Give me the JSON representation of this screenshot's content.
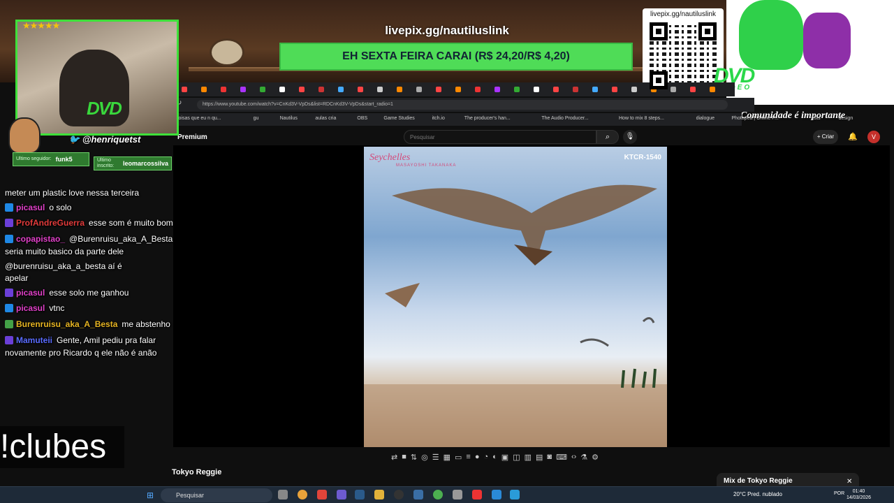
{
  "overlay": {
    "livepix": "livepix.gg/nautiluslink",
    "goal_text": "EH SEXTA FEIRA CARAI (R$ 24,20/R$ 4,20)",
    "qr_url": "livepix.gg/nautiluslink",
    "dvd_logo": "DVD",
    "dvd_sub": "VIDEO",
    "community": "Comunidade é importante",
    "stars": "★★★★★",
    "twitter_handle": "@henriquetst",
    "last_follower_label": "Ultimo seguidor:",
    "last_follower": "funk5",
    "last_sub_label": "Ultimo inscrito:",
    "last_sub": "leomarcossilva",
    "clubes": "!clubes"
  },
  "chat": [
    {
      "user": "",
      "color": "#ffffff",
      "text": "meter um plastic love nessa terceira"
    },
    {
      "user": "picasul",
      "color": "#e040c8",
      "text": "o solo"
    },
    {
      "user": "ProfAndreGuerra",
      "color": "#e33b3b",
      "text": "esse som é muito bom"
    },
    {
      "user": "copapistao_",
      "color": "#e040c8",
      "text": "@Burenruisu_aka_A_Besta"
    },
    {
      "user": "",
      "color": "#ffffff",
      "text": "seria muito basico da parte dele"
    },
    {
      "user": "",
      "color": "#ffffff",
      "text": "@burenruisu_aka_a_besta aí é"
    },
    {
      "user": "",
      "color": "#ffffff",
      "text": "apelar"
    },
    {
      "user": "picasul",
      "color": "#e040c8",
      "text": "esse solo me ganhou"
    },
    {
      "user": "picasul",
      "color": "#e040c8",
      "text": "vtnc"
    },
    {
      "user": "Burenruisu_aka_A_Besta",
      "color": "#e6b422",
      "text": "me abstenho"
    },
    {
      "user": "Mamuteii",
      "color": "#5a6cff",
      "text": "Gente, Amil pediu pra falar"
    },
    {
      "user": "",
      "color": "#ffffff",
      "text": "novamente pro Ricardo q ele não é anão"
    }
  ],
  "browser": {
    "url": "https://www.youtube.com/watch?v=CnKd3V-VpDs&list=RDCnKd3V-VpDs&start_radio=1",
    "bookmarks": [
      "coisas que eu n qu...",
      "gu",
      "Nautilus",
      "aulas cria",
      "OBS",
      "Game Studies",
      "itch.io",
      "The producer's han...",
      "The Audio Producer...",
      "How to mix 8 steps...",
      "dialogue",
      "Photopea | Online P...",
      "lists",
      "design"
    ]
  },
  "youtube": {
    "premium": "Premium",
    "search_placeholder": "Pesquisar",
    "create": "Criar",
    "avatar_letter": "V",
    "video_title": "Tokyo Reggie",
    "cover_title": "Seychelles",
    "cover_artist": "MASAYOSHI TAKANAKA",
    "cover_code": "KTCR-1540",
    "mix_title": "Mix de Tokyo Reggie"
  },
  "taskbar": {
    "search": "Pesquisar",
    "weather": "20°C  Pred. nublado",
    "lang": "POR",
    "time": "01:40",
    "date": "14/03/2026"
  }
}
